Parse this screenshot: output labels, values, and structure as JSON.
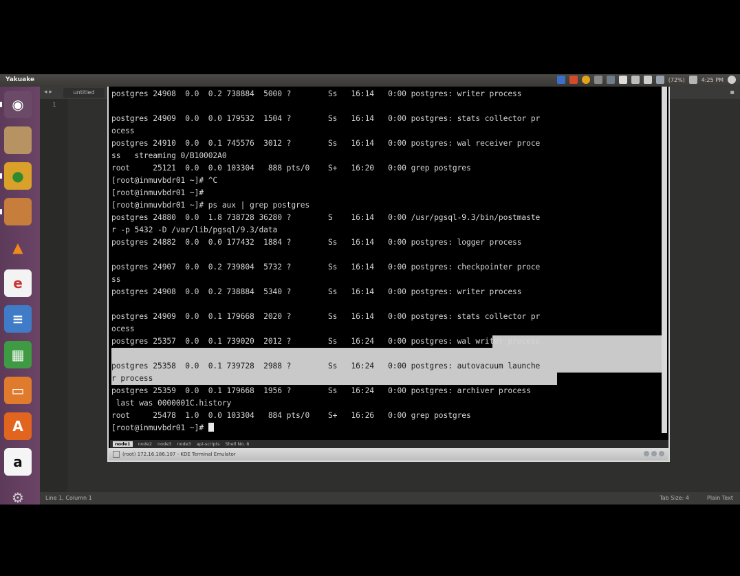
{
  "panel": {
    "app_title": "Yakuake",
    "tray_text": "(72%)",
    "clock": "4:25 PM",
    "accent": "#3c6fc7"
  },
  "launcher": {
    "items": [
      {
        "icon": "ubuntu-dash-icon",
        "glyph": "◉",
        "bg": "#6a4a66",
        "fg": "#ffffff"
      },
      {
        "icon": "files-icon",
        "glyph": "",
        "bg": "#b79263",
        "fg": "#fff"
      },
      {
        "icon": "chrome-icon",
        "glyph": "●",
        "bg": "#d9a12a",
        "fg": "#2f8b2f"
      },
      {
        "icon": "image-viewer-icon",
        "glyph": "",
        "bg": "#c77d3c",
        "fg": "#fff"
      },
      {
        "icon": "vlc-icon",
        "glyph": "▲",
        "bg": "#ffffff00",
        "fg": "#f08a1c"
      },
      {
        "icon": "text-editor-icon",
        "glyph": "e",
        "bg": "#f3f3f3",
        "fg": "#c33"
      },
      {
        "icon": "writer-icon",
        "glyph": "≡",
        "bg": "#3f7bc6",
        "fg": "#fff"
      },
      {
        "icon": "calc-icon",
        "glyph": "▦",
        "bg": "#3e9a43",
        "fg": "#fff"
      },
      {
        "icon": "impress-icon",
        "glyph": "▭",
        "bg": "#e07a2c",
        "fg": "#fff"
      },
      {
        "icon": "software-center-icon",
        "glyph": "A",
        "bg": "#e2651f",
        "fg": "#fff"
      },
      {
        "icon": "amazon-icon",
        "glyph": "a",
        "bg": "#f5f5f5",
        "fg": "#111"
      },
      {
        "icon": "settings-icon",
        "glyph": "⚙",
        "bg": "#ffffff00",
        "fg": "#cfcfcf"
      }
    ]
  },
  "editor": {
    "tab_label": "untitled",
    "line_number": "1",
    "status_left": "Line 1, Column 1",
    "tab_size": "Tab Size: 4",
    "syntax": "Plain Text"
  },
  "terminal": {
    "lines": [
      "postgres 24908  0.0  0.2 738884  5000 ?        Ss   16:14   0:00 postgres: writer process",
      "",
      "postgres 24909  0.0  0.0 179532  1504 ?        Ss   16:14   0:00 postgres: stats collector pr",
      "ocess",
      "postgres 24910  0.0  0.1 745576  3012 ?        Ss   16:14   0:00 postgres: wal receiver proce",
      "ss   streaming 0/B10002A0",
      "root     25121  0.0  0.0 103304   888 pts/0    S+   16:20   0:00 grep postgres",
      "[root@inmuvbdr01 ~]# ^C",
      "[root@inmuvbdr01 ~]#",
      "[root@inmuvbdr01 ~]# ps aux | grep postgres",
      "postgres 24880  0.0  1.8 738728 36280 ?        S    16:14   0:00 /usr/pgsql-9.3/bin/postmaste",
      "r -p 5432 -D /var/lib/pgsql/9.3/data",
      "postgres 24882  0.0  0.0 177432  1884 ?        Ss   16:14   0:00 postgres: logger process",
      "",
      "postgres 24907  0.0  0.2 739804  5732 ?        Ss   16:14   0:00 postgres: checkpointer proce",
      "ss",
      "postgres 24908  0.0  0.2 738884  5340 ?        Ss   16:14   0:00 postgres: writer process",
      "",
      "postgres 24909  0.0  0.1 179668  2020 ?        Ss   16:14   0:00 postgres: stats collector pr",
      "ocess",
      "postgres 25357  0.0  0.1 739020  2012 ?        Ss   16:24   0:00 postgres: wal writer process",
      "",
      "postgres 25358  0.0  0.1 739728  2988 ?        Ss   16:24   0:00 postgres: autovacuum launche",
      "r process",
      "postgres 25359  0.0  0.1 179668  1956 ?        Ss   16:24   0:00 postgres: archiver process",
      " last was 0000001C.history",
      "root     25478  1.0  0.0 103304   884 pts/0    S+   16:26   0:00 grep postgres",
      "[root@inmuvbdr01 ~]# "
    ],
    "tabs": [
      "node1",
      "node2",
      "node3",
      "node3",
      "api-scripts",
      "Shell No. 8"
    ],
    "window_title": "(root) 172.16.186.107 - KDE Terminal Emulator"
  }
}
